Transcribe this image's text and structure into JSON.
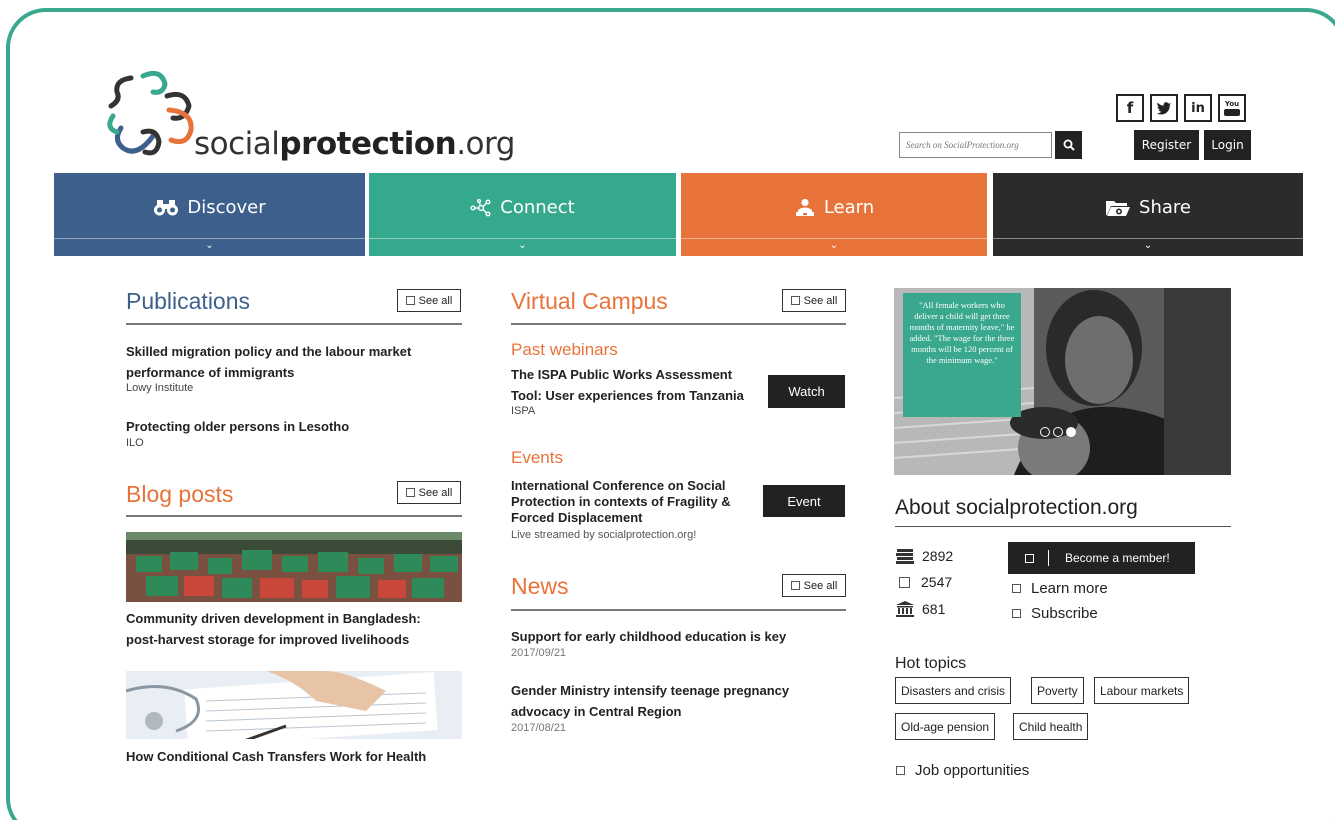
{
  "header": {
    "logo_light": "social",
    "logo_bold": "protection",
    "logo_suffix": ".org",
    "search_placeholder": "Search on SocialProtection.org",
    "social": [
      {
        "name": "facebook",
        "glyph": "f"
      },
      {
        "name": "twitter",
        "glyph": "t"
      },
      {
        "name": "linkedin",
        "glyph": "in"
      },
      {
        "name": "youtube",
        "glyph": "You"
      }
    ],
    "register_label": "Register",
    "login_label": "Login"
  },
  "nav": [
    {
      "label": "Discover",
      "color": "#3d5f8c",
      "icon": "binoculars-icon"
    },
    {
      "label": "Connect",
      "color": "#35a98e",
      "icon": "network-icon"
    },
    {
      "label": "Learn",
      "color": "#e8733a",
      "icon": "learner-icon"
    },
    {
      "label": "Share",
      "color": "#2b2b2b",
      "icon": "folder-icon"
    }
  ],
  "publications": {
    "title": "Publications",
    "see_all": "See all",
    "items": [
      {
        "title_line1": "Skilled migration policy and the labour market",
        "title_line2": "performance of immigrants",
        "source": "Lowy Institute"
      },
      {
        "title_line1": "Protecting older persons in Lesotho",
        "source": "ILO"
      }
    ]
  },
  "blog": {
    "title": "Blog posts",
    "see_all": "See all",
    "items": [
      {
        "title_line1": "Community driven development in Bangladesh:",
        "title_line2": "post-harvest storage for improved livelihoods"
      },
      {
        "title_line1": "How Conditional Cash Transfers Work for Health"
      }
    ]
  },
  "campus": {
    "title": "Virtual Campus",
    "see_all": "See all",
    "webinars_heading": "Past webinars",
    "webinar": {
      "title_line1": "The ISPA Public Works Assessment",
      "title_line2": "Tool: User experiences from Tanzania",
      "source": "ISPA",
      "button": "Watch"
    },
    "events_heading": "Events",
    "event": {
      "title_line1": "International Conference on Social",
      "title_line2": "Protection in contexts of Fragility &",
      "title_line3": "Forced Displacement",
      "note": "Live streamed by socialprotection.org!",
      "button": "Event"
    }
  },
  "news": {
    "title": "News",
    "see_all": "See all",
    "items": [
      {
        "title_line1": "Support for early childhood education is key",
        "date": "2017/09/21"
      },
      {
        "title_line1": "Gender Ministry intensify teenage pregnancy",
        "title_line2": "advocacy in Central Region",
        "date": "2017/08/21"
      }
    ]
  },
  "hero": {
    "quote": "\"All female workers who deliver a child will get three months of maternity leave,\" he added. \"The wage for the three months will be 120 percent of the minimum wage.\"",
    "slides": 3,
    "active_slide": 3
  },
  "about": {
    "title": "About socialprotection.org",
    "stats": [
      {
        "icon": "books-icon",
        "value": "2892"
      },
      {
        "icon": "square-icon",
        "value": "2547"
      },
      {
        "icon": "institution-icon",
        "value": "681"
      }
    ],
    "member_button": "Become a member!",
    "learn_more": "Learn more",
    "subscribe": "Subscribe"
  },
  "hot_topics": {
    "title": "Hot topics",
    "row1": [
      "Disasters and crisis",
      "Poverty",
      "Labour markets"
    ],
    "row2": [
      "Old-age pension",
      "Child health"
    ]
  },
  "jobs_label": "Job opportunities"
}
